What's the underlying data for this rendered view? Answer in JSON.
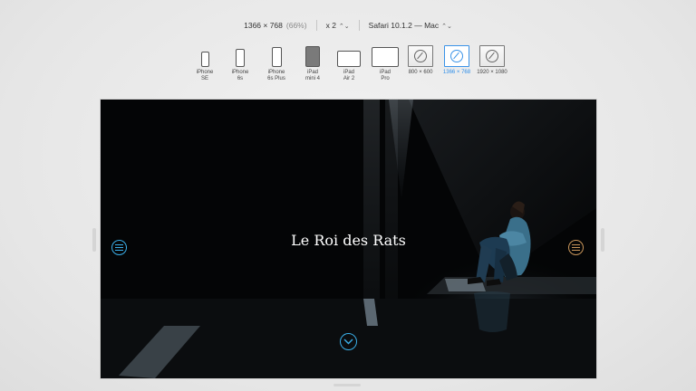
{
  "toolbar": {
    "resolution": "1366 × 768",
    "percent": "(66%)",
    "scale": "x 2",
    "browser": "Safari 10.1.2 — Mac"
  },
  "devices": [
    {
      "label": "iPhone\nSE",
      "icon": "iphone-icon"
    },
    {
      "label": "iPhone\n6s",
      "icon": "iphone-icon"
    },
    {
      "label": "iPhone\n6s Plus",
      "icon": "iphone-icon"
    },
    {
      "label": "iPad\nmini 4",
      "icon": "ipad-icon"
    },
    {
      "label": "iPad\nAir 2",
      "icon": "ipad-landscape-icon"
    },
    {
      "label": "iPad\nPro",
      "icon": "ipad-pro-icon"
    },
    {
      "label": "800 × 600",
      "icon": "safari-compass-icon"
    },
    {
      "label": "1366 × 768",
      "icon": "safari-compass-icon",
      "active": true
    },
    {
      "label": "1920 × 1080",
      "icon": "safari-compass-icon"
    }
  ],
  "hero": {
    "title": "Le Roi des Rats"
  },
  "colors": {
    "accent_blue": "#3aaee8",
    "accent_gold": "#c8955a",
    "active_device": "#2f8ee8"
  }
}
